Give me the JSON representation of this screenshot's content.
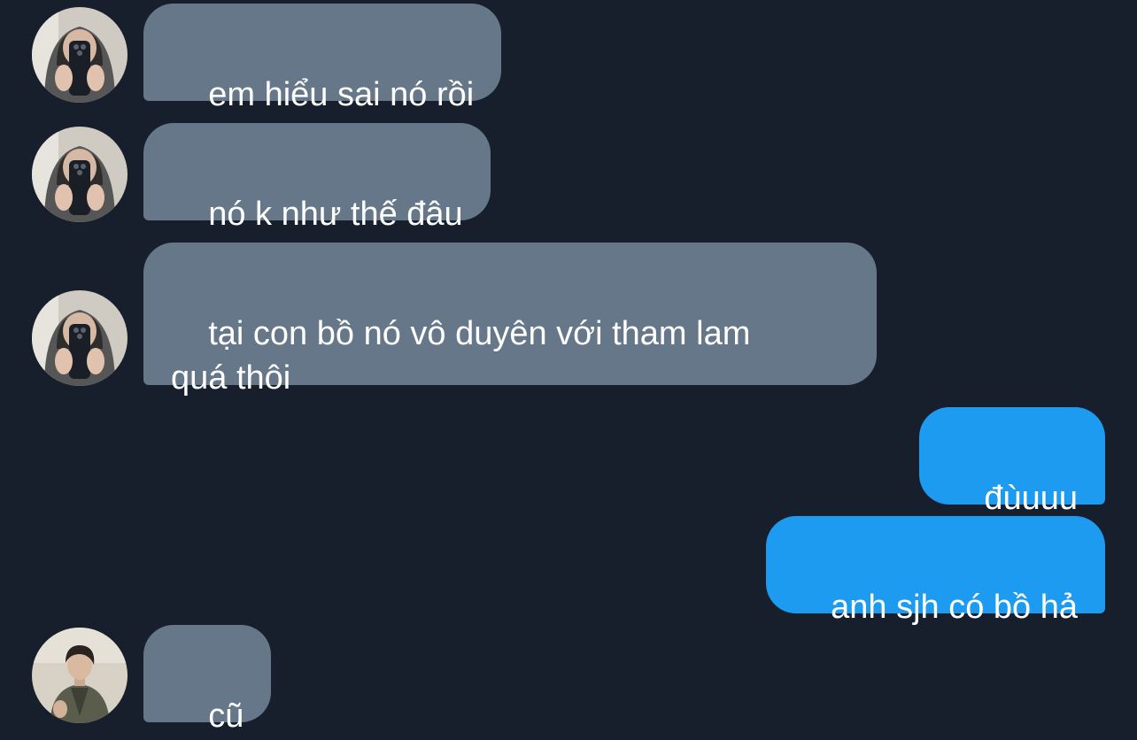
{
  "conversation": {
    "messages": [
      {
        "sender": "other",
        "avatar_icon": "hooded-selfie-avatar-icon",
        "text": "em hiểu sai nó rồi"
      },
      {
        "sender": "other",
        "avatar_icon": "hooded-selfie-avatar-icon",
        "text": "nó k như thế đâu"
      },
      {
        "sender": "other",
        "avatar_icon": "hooded-selfie-avatar-icon",
        "text": "tại con bồ nó vô duyên với tham lam\nquá thôi"
      },
      {
        "sender": "me",
        "text": "đùuuu"
      },
      {
        "sender": "me",
        "text": "anh sjh có bồ hả"
      },
      {
        "sender": "other",
        "avatar_icon": "jacket-portrait-avatar-icon",
        "text": "cũ"
      }
    ]
  },
  "colors": {
    "background": "#161f2b",
    "incoming_bubble": "#657789",
    "outgoing_bubble": "#1d9bf0",
    "text": "#ffffff"
  }
}
